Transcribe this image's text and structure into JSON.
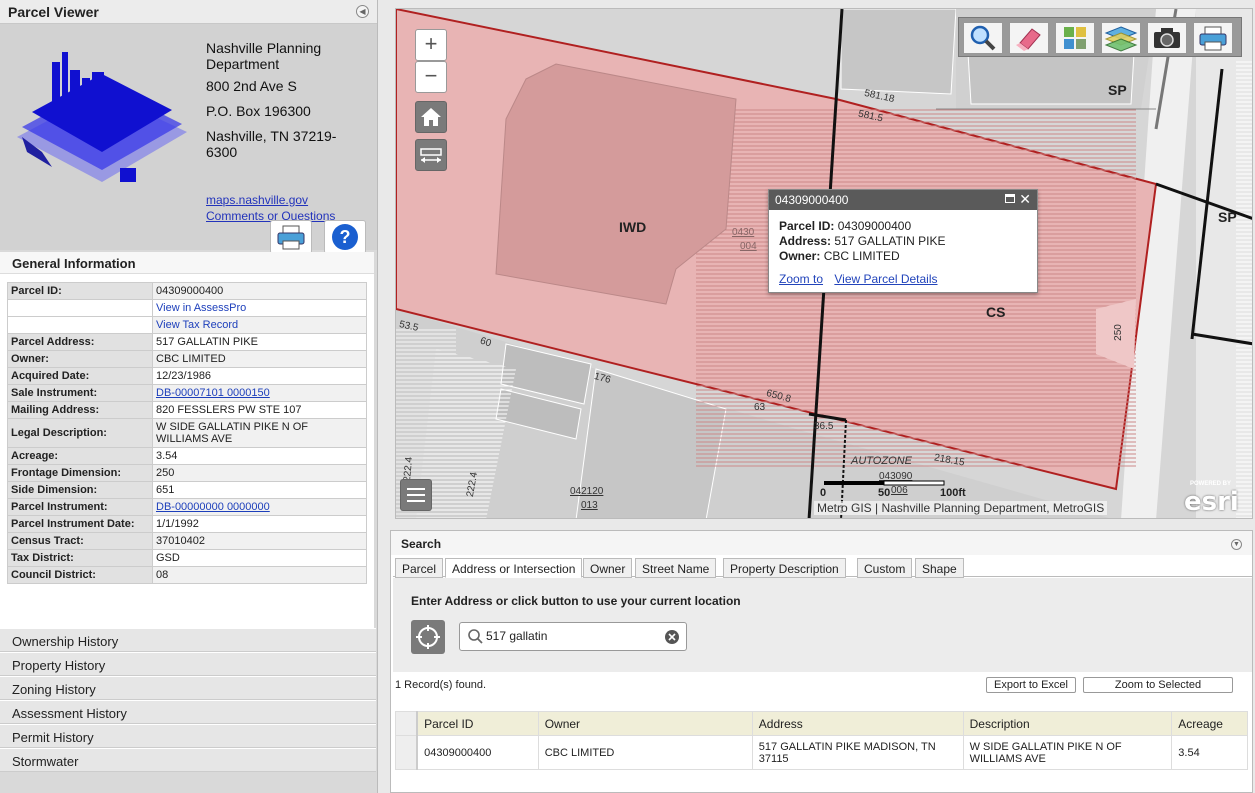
{
  "left_panel": {
    "title": "Parcel Viewer",
    "contact": {
      "org": "Nashville Planning Department",
      "street": "800 2nd Ave S",
      "po_box": "P.O. Box 196300",
      "city": "Nashville, TN 37219-6300",
      "link_site": "maps.nashville.gov",
      "link_comments": "Comments or Questions"
    },
    "general_info": {
      "heading": "General Information",
      "rows": [
        {
          "label": "Parcel ID:",
          "value": "04309000400",
          "type": "text"
        },
        {
          "label": "",
          "value": "View in AssessPro",
          "type": "link"
        },
        {
          "label": "",
          "value": "View Tax Record",
          "type": "link"
        },
        {
          "label": "Parcel Address:",
          "value": "517 GALLATIN PIKE",
          "type": "text"
        },
        {
          "label": "Owner:",
          "value": "CBC LIMITED",
          "type": "text"
        },
        {
          "label": "Acquired Date:",
          "value": "12/23/1986",
          "type": "text"
        },
        {
          "label": "Sale Instrument:",
          "value": "DB-00007101 0000150",
          "type": "ulink"
        },
        {
          "label": "Mailing Address:",
          "value": "820 FESSLERS PW STE 107",
          "type": "text"
        },
        {
          "label": "Legal Description:",
          "value": "W SIDE GALLATIN PIKE N OF WILLIAMS AVE",
          "type": "text"
        },
        {
          "label": "Acreage:",
          "value": "3.54",
          "type": "text"
        },
        {
          "label": "Frontage Dimension:",
          "value": "250",
          "type": "text"
        },
        {
          "label": "Side Dimension:",
          "value": "651",
          "type": "text"
        },
        {
          "label": "Parcel Instrument:",
          "value": "DB-00000000 0000000",
          "type": "ulink"
        },
        {
          "label": "Parcel Instrument Date:",
          "value": "1/1/1992",
          "type": "text"
        },
        {
          "label": "Census Tract:",
          "value": "37010402",
          "type": "text"
        },
        {
          "label": "Tax District:",
          "value": "GSD",
          "type": "text"
        },
        {
          "label": "Council District:",
          "value": "08",
          "type": "text"
        }
      ]
    },
    "history": [
      "Ownership History",
      "Property History",
      "Zoning History",
      "Assessment History",
      "Permit History",
      "Stormwater"
    ]
  },
  "map": {
    "zoom_in": "+",
    "zoom_out": "−",
    "zone_labels": {
      "iwd": "IWD",
      "cs": "CS",
      "sp1": "SP",
      "sp2": "SP",
      "autozone": "AUTOZONE"
    },
    "dims": {
      "d1": "581.18",
      "d2": "581.5",
      "d3": "650.8",
      "d4": "250",
      "d5": "218.15",
      "d6": "36.5",
      "d7": "63",
      "d8": "176",
      "d9": "60",
      "d10": "53.5",
      "d11": "222.4",
      "d12": "222.4",
      "d13": "042120",
      "d14": "013",
      "d15": "0430",
      "d16": "004",
      "d17": "043090",
      "d18": "006"
    },
    "popup": {
      "title": "04309000400",
      "parcel_label": "Parcel ID:",
      "parcel_value": "04309000400",
      "address_label": "Address:",
      "address_value": "517 GALLATIN PIKE",
      "owner_label": "Owner:",
      "owner_value": "CBC LIMITED",
      "zoom_link": "Zoom to",
      "details_link": "View Parcel Details"
    },
    "scale": {
      "s0": "0",
      "s50": "50",
      "s100": "100ft"
    },
    "attribution": "Metro GIS | Nashville Planning Department, MetroGIS",
    "esri_powered": "POWERED BY",
    "esri_name": "esri"
  },
  "search": {
    "heading": "Search",
    "tabs": [
      "Parcel",
      "Address or Intersection",
      "Owner",
      "Street Name",
      "Property Description",
      "Custom",
      "Shape"
    ],
    "active_tab": 1,
    "instruction": "Enter Address or click button to use your current location",
    "query": "517 gallatin",
    "records_found": "1 Record(s) found.",
    "export_btn": "Export to Excel",
    "zoom_btn": "Zoom to Selected",
    "columns": [
      "Parcel ID",
      "Owner",
      "Address",
      "Description",
      "Acreage"
    ],
    "rows": [
      {
        "parcel_id": "04309000400",
        "owner": "CBC LIMITED",
        "address": "517 GALLATIN PIKE MADISON, TN 37115",
        "description": "W SIDE GALLATIN PIKE N OF WILLIAMS AVE",
        "acreage": "3.54"
      }
    ]
  },
  "colors": {
    "parcel_fill": "#e8b4b4",
    "parcel_stroke": "#b02020",
    "accent_link": "#2233bb"
  }
}
